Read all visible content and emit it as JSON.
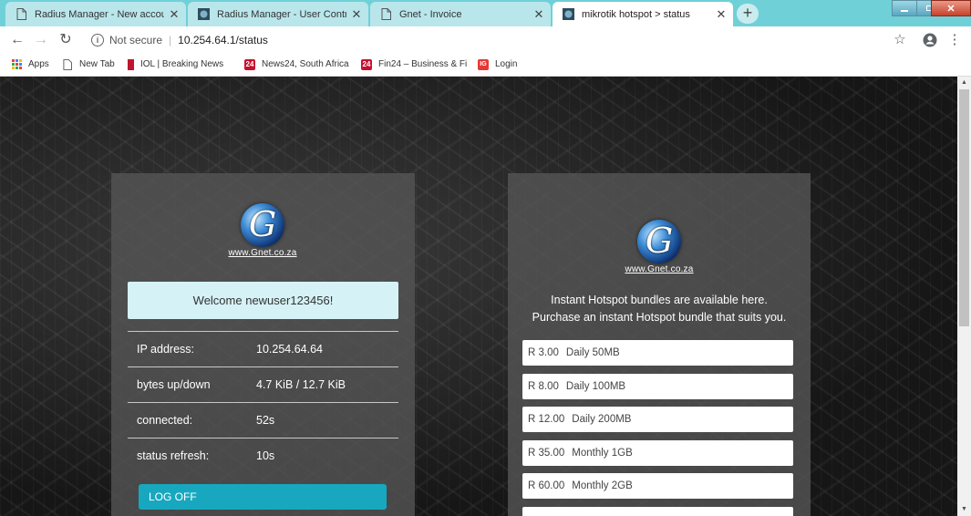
{
  "browser": {
    "tabs": [
      {
        "title": "Radius Manager - New account",
        "icon": "page-icon",
        "active": false
      },
      {
        "title": "Radius Manager - User Control P",
        "icon": "site-favicon",
        "active": false
      },
      {
        "title": "Gnet - Invoice",
        "icon": "page-icon",
        "active": false
      },
      {
        "title": "mikrotik hotspot > status",
        "icon": "site-favicon",
        "active": true
      }
    ],
    "new_tab_symbol": "+",
    "address": {
      "security": "Not secure",
      "url": "10.254.64.1/status"
    },
    "bookmarks": [
      {
        "label": "Apps",
        "icon": "apps-grid-icon"
      },
      {
        "label": "New Tab",
        "icon": "page-icon"
      },
      {
        "label": "IOL | Breaking News",
        "icon": "iol-icon"
      },
      {
        "label": "News24, South Africa",
        "icon": "news24-icon",
        "badge": "24"
      },
      {
        "label": "Fin24 – Business & Fi",
        "icon": "fin24-icon",
        "badge": "24"
      },
      {
        "label": "Login",
        "icon": "ig-icon",
        "badge": "IG"
      }
    ],
    "colors": {
      "tabstrip": "#6fd0d8",
      "accent": "#17a8bf"
    }
  },
  "left_panel": {
    "logo_site": "www.Gnet.co.za",
    "logo_letter": "G",
    "welcome": "Welcome newuser123456!",
    "rows": [
      {
        "label": "IP address:",
        "value": "10.254.64.64"
      },
      {
        "label": "bytes up/down",
        "value": "4.7 KiB / 12.7 KiB"
      },
      {
        "label": "connected:",
        "value": "52s"
      },
      {
        "label": "status refresh:",
        "value": "10s"
      }
    ],
    "logoff_label": "LOG OFF"
  },
  "right_panel": {
    "logo_site": "www.Gnet.co.za",
    "logo_letter": "G",
    "promo_line1": "Instant Hotspot bundles are available here.",
    "promo_line2": "Purchase an instant Hotspot bundle that suits you.",
    "bundles": [
      {
        "price": "R 3.00",
        "name": "Daily 50MB"
      },
      {
        "price": "R 8.00",
        "name": "Daily 100MB"
      },
      {
        "price": "R 12.00",
        "name": "Daily 200MB"
      },
      {
        "price": "R 35.00",
        "name": "Monthly 1GB"
      },
      {
        "price": "R 60.00",
        "name": "Monthly 2GB"
      }
    ]
  }
}
